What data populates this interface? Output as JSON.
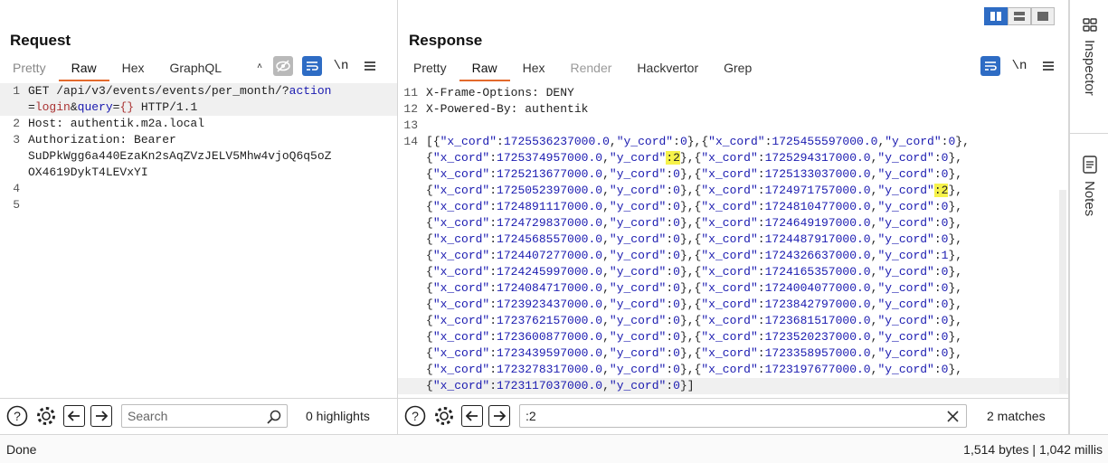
{
  "request": {
    "title": "Request",
    "tabs": [
      "Pretty",
      "Raw",
      "Hex",
      "GraphQL"
    ],
    "active_tab": "Raw",
    "lines": [
      {
        "n": "1",
        "parts": [
          [
            "GET /api/v3/events/events/per_month/?",
            ""
          ],
          [
            "action",
            "k"
          ]
        ]
      },
      {
        "n": "",
        "parts": [
          [
            "=",
            ""
          ],
          [
            "login",
            "o"
          ],
          [
            "&",
            ""
          ],
          [
            "query",
            "k"
          ],
          [
            "=",
            ""
          ],
          [
            "{}",
            "o"
          ],
          [
            " HTTP/1.1",
            ""
          ]
        ]
      },
      {
        "n": "2",
        "parts": [
          [
            "Host: authentik.m2a.local",
            ""
          ]
        ]
      },
      {
        "n": "3",
        "parts": [
          [
            "Authorization: Bearer",
            ""
          ]
        ]
      },
      {
        "n": "",
        "parts": [
          [
            "SuDPkWgg6a440EzaKn2sAqZVzJELV5Mhw4vjoQ6q5oZ",
            ""
          ]
        ]
      },
      {
        "n": "",
        "parts": [
          [
            "OX4619DykT4LEVxYI",
            ""
          ]
        ]
      },
      {
        "n": "4",
        "parts": [
          [
            "",
            ""
          ]
        ]
      },
      {
        "n": "5",
        "parts": [
          [
            "",
            ""
          ]
        ]
      }
    ],
    "search_placeholder": "Search",
    "highlights": "0 highlights"
  },
  "response": {
    "title": "Response",
    "tabs": [
      "Pretty",
      "Raw",
      "Hex",
      "Render",
      "Hackvertor",
      "Grep"
    ],
    "active_tab": "Raw",
    "header_lines": [
      {
        "n": "11",
        "text": "X-Frame-Options: DENY"
      },
      {
        "n": "12",
        "text": "X-Powered-By: authentik"
      },
      {
        "n": "13",
        "text": ""
      }
    ],
    "body_line_number": "14",
    "search_value": ":2",
    "matches": "2 matches",
    "records": [
      {
        "x": "1725536237000.0",
        "y": "0"
      },
      {
        "x": "1725455597000.0",
        "y": "0"
      },
      {
        "x": "1725374957000.0",
        "y": "2"
      },
      {
        "x": "1725294317000.0",
        "y": "0"
      },
      {
        "x": "1725213677000.0",
        "y": "0"
      },
      {
        "x": "1725133037000.0",
        "y": "0"
      },
      {
        "x": "1725052397000.0",
        "y": "0"
      },
      {
        "x": "1724971757000.0",
        "y": "2"
      },
      {
        "x": "1724891117000.0",
        "y": "0"
      },
      {
        "x": "1724810477000.0",
        "y": "0"
      },
      {
        "x": "1724729837000.0",
        "y": "0"
      },
      {
        "x": "1724649197000.0",
        "y": "0"
      },
      {
        "x": "1724568557000.0",
        "y": "0"
      },
      {
        "x": "1724487917000.0",
        "y": "0"
      },
      {
        "x": "1724407277000.0",
        "y": "0"
      },
      {
        "x": "1724326637000.0",
        "y": "1"
      },
      {
        "x": "1724245997000.0",
        "y": "0"
      },
      {
        "x": "1724165357000.0",
        "y": "0"
      },
      {
        "x": "1724084717000.0",
        "y": "0"
      },
      {
        "x": "1724004077000.0",
        "y": "0"
      },
      {
        "x": "1723923437000.0",
        "y": "0"
      },
      {
        "x": "1723842797000.0",
        "y": "0"
      },
      {
        "x": "1723762157000.0",
        "y": "0"
      },
      {
        "x": "1723681517000.0",
        "y": "0"
      },
      {
        "x": "1723600877000.0",
        "y": "0"
      },
      {
        "x": "1723520237000.0",
        "y": "0"
      },
      {
        "x": "1723439597000.0",
        "y": "0"
      },
      {
        "x": "1723358957000.0",
        "y": "0"
      },
      {
        "x": "1723278317000.0",
        "y": "0"
      },
      {
        "x": "1723197677000.0",
        "y": "0"
      },
      {
        "x": "1723117037000.0",
        "y": "0"
      }
    ]
  },
  "side": {
    "inspector": "Inspector",
    "notes": "Notes"
  },
  "status": {
    "left": "Done",
    "right": "1,514 bytes | 1,042 millis"
  }
}
